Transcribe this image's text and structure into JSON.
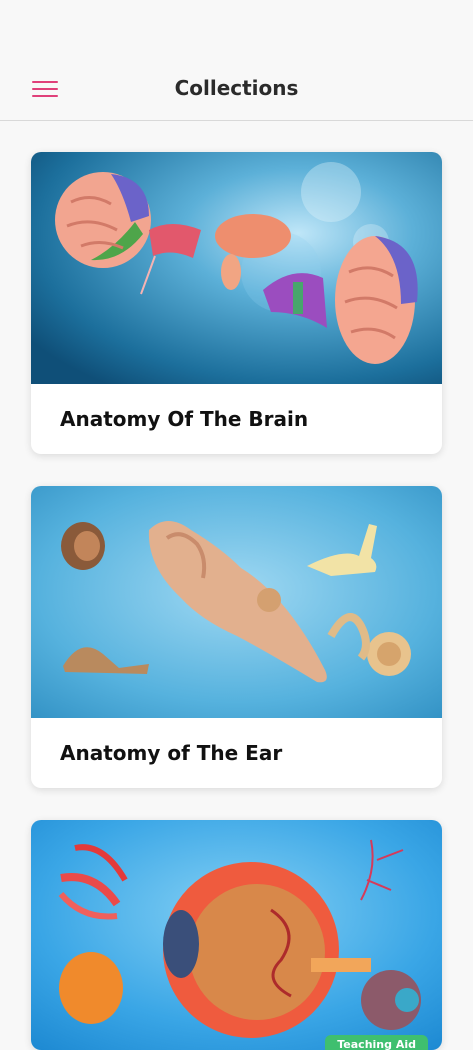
{
  "header": {
    "title": "Collections"
  },
  "collections": [
    {
      "label": "Anatomy Of The Brain"
    },
    {
      "label": "Anatomy of The Ear"
    },
    {
      "label": "",
      "badge": "Teaching Aid"
    }
  ]
}
